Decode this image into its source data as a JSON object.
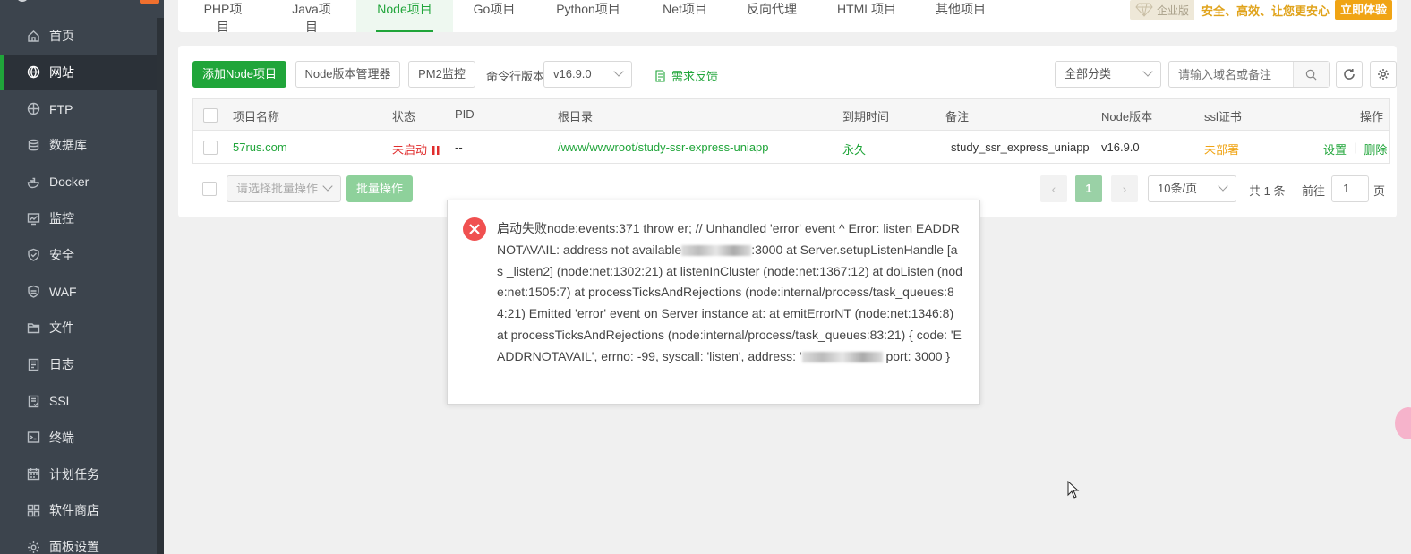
{
  "sidebar": {
    "items": [
      {
        "label": "首页",
        "icon": "home-icon"
      },
      {
        "label": "网站",
        "icon": "globe-icon",
        "active": true
      },
      {
        "label": "FTP",
        "icon": "ftp-icon"
      },
      {
        "label": "数据库",
        "icon": "database-icon"
      },
      {
        "label": "Docker",
        "icon": "docker-icon"
      },
      {
        "label": "监控",
        "icon": "monitor-icon"
      },
      {
        "label": "安全",
        "icon": "shield-icon"
      },
      {
        "label": "WAF",
        "icon": "waf-icon"
      },
      {
        "label": "文件",
        "icon": "folder-icon"
      },
      {
        "label": "日志",
        "icon": "log-icon"
      },
      {
        "label": "SSL",
        "icon": "ssl-icon"
      },
      {
        "label": "终端",
        "icon": "terminal-icon"
      },
      {
        "label": "计划任务",
        "icon": "calendar-icon"
      },
      {
        "label": "软件商店",
        "icon": "apps-icon"
      },
      {
        "label": "面板设置",
        "icon": "gear-icon"
      }
    ],
    "accent": "#20a53a"
  },
  "tabs": {
    "items": [
      "PHP项目",
      "Java项目",
      "Node项目",
      "Go项目",
      "Python项目",
      "Net项目",
      "反向代理",
      "HTML项目",
      "其他项目"
    ],
    "active": "Node项目"
  },
  "promo": {
    "edition": "企业版",
    "slogan": "安全、高效、让您更安心",
    "try_label": "立即体验"
  },
  "toolbar": {
    "add_node": "添加Node项目",
    "version_manager": "Node版本管理器",
    "pm2": "PM2监控",
    "cli_version_label": "命令行版本",
    "cli_version_value": "v16.9.0",
    "feedback": "需求反馈",
    "category": "全部分类",
    "search_placeholder": "请输入域名或备注"
  },
  "table": {
    "headers": {
      "name": "项目名称",
      "status": "状态",
      "pid": "PID",
      "root": "根目录",
      "expire": "到期时间",
      "remark": "备注",
      "node_version": "Node版本",
      "ssl": "ssl证书",
      "ops": "操作"
    },
    "rows": [
      {
        "name": "57rus.com",
        "status": "未启动",
        "pid": "--",
        "root": "/www/wwwroot/study-ssr-express-uniapp",
        "expire": "永久",
        "remark": "study_ssr_express_uniapp",
        "node_version": "v16.9.0",
        "ssl": "未部署",
        "op_settings": "设置",
        "op_delete": "删除"
      }
    ]
  },
  "bottom": {
    "batch_select": "请选择批量操作",
    "batch_button": "批量操作",
    "current_page": "1",
    "page_size": "10条/页",
    "total": "共 1 条",
    "goto_label": "前往",
    "goto_value": "1",
    "page_unit": "页"
  },
  "modal": {
    "part1": "启动失败node:events:371 throw er; // Unhandled 'error' event ^ Error: listen EADDRNOTAVAIL: address not available",
    "part2": ":3000 at Server.setupListenHandle [as _listen2] (node:net:1302:21) at listenInCluster (node:net:1367:12) at doListen (node:net:1505:7) at processTicksAndRejections (node:internal/process/task_queues:84:21) Emitted 'error' event on Server instance at: at emitErrorNT (node:net:1346:8) at processTicksAndRejections (node:internal/process/task_queues:83:21) { code: 'EADDRNOTAVAIL', errno: -99, syscall: 'listen', address: '",
    "part3": " port: 3000 }"
  }
}
